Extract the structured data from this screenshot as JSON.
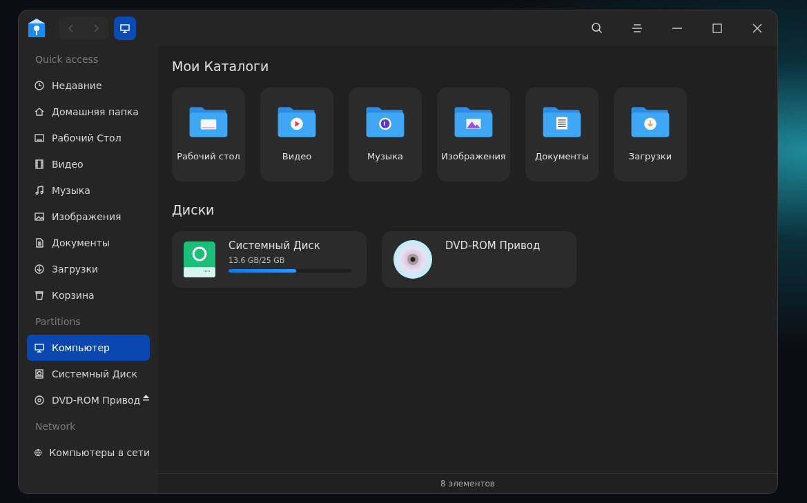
{
  "sidebar": {
    "sections": [
      {
        "title": "Quick access",
        "items": [
          {
            "label": "Недавние",
            "selected": false
          },
          {
            "label": "Домашняя папка",
            "selected": false
          },
          {
            "label": "Рабочий Стол",
            "selected": false
          },
          {
            "label": "Видео",
            "selected": false
          },
          {
            "label": "Музыка",
            "selected": false
          },
          {
            "label": "Изображения",
            "selected": false
          },
          {
            "label": "Документы",
            "selected": false
          },
          {
            "label": "Загрузки",
            "selected": false
          },
          {
            "label": "Корзина",
            "selected": false
          }
        ]
      },
      {
        "title": "Partitions",
        "items": [
          {
            "label": "Компьютер",
            "selected": true
          },
          {
            "label": "Системный Диск",
            "selected": false
          },
          {
            "label": "DVD-ROM Привод",
            "selected": false,
            "ejectable": true
          }
        ]
      },
      {
        "title": "Network",
        "items": [
          {
            "label": "Компьютеры в сети",
            "selected": false
          }
        ]
      }
    ]
  },
  "folders_title": "Мои Каталоги",
  "folders": [
    {
      "label": "Рабочий стол"
    },
    {
      "label": "Видео"
    },
    {
      "label": "Музыка"
    },
    {
      "label": "Изображения"
    },
    {
      "label": "Документы"
    },
    {
      "label": "Загрузки"
    }
  ],
  "disks_title": "Диски",
  "disks": [
    {
      "kind": "drive",
      "name": "Системный Диск",
      "usage": "13.6 GB/25 GB",
      "level": 0.55
    },
    {
      "kind": "optical",
      "name": "DVD-ROM Привод"
    }
  ],
  "status_bar": "8 элементов"
}
